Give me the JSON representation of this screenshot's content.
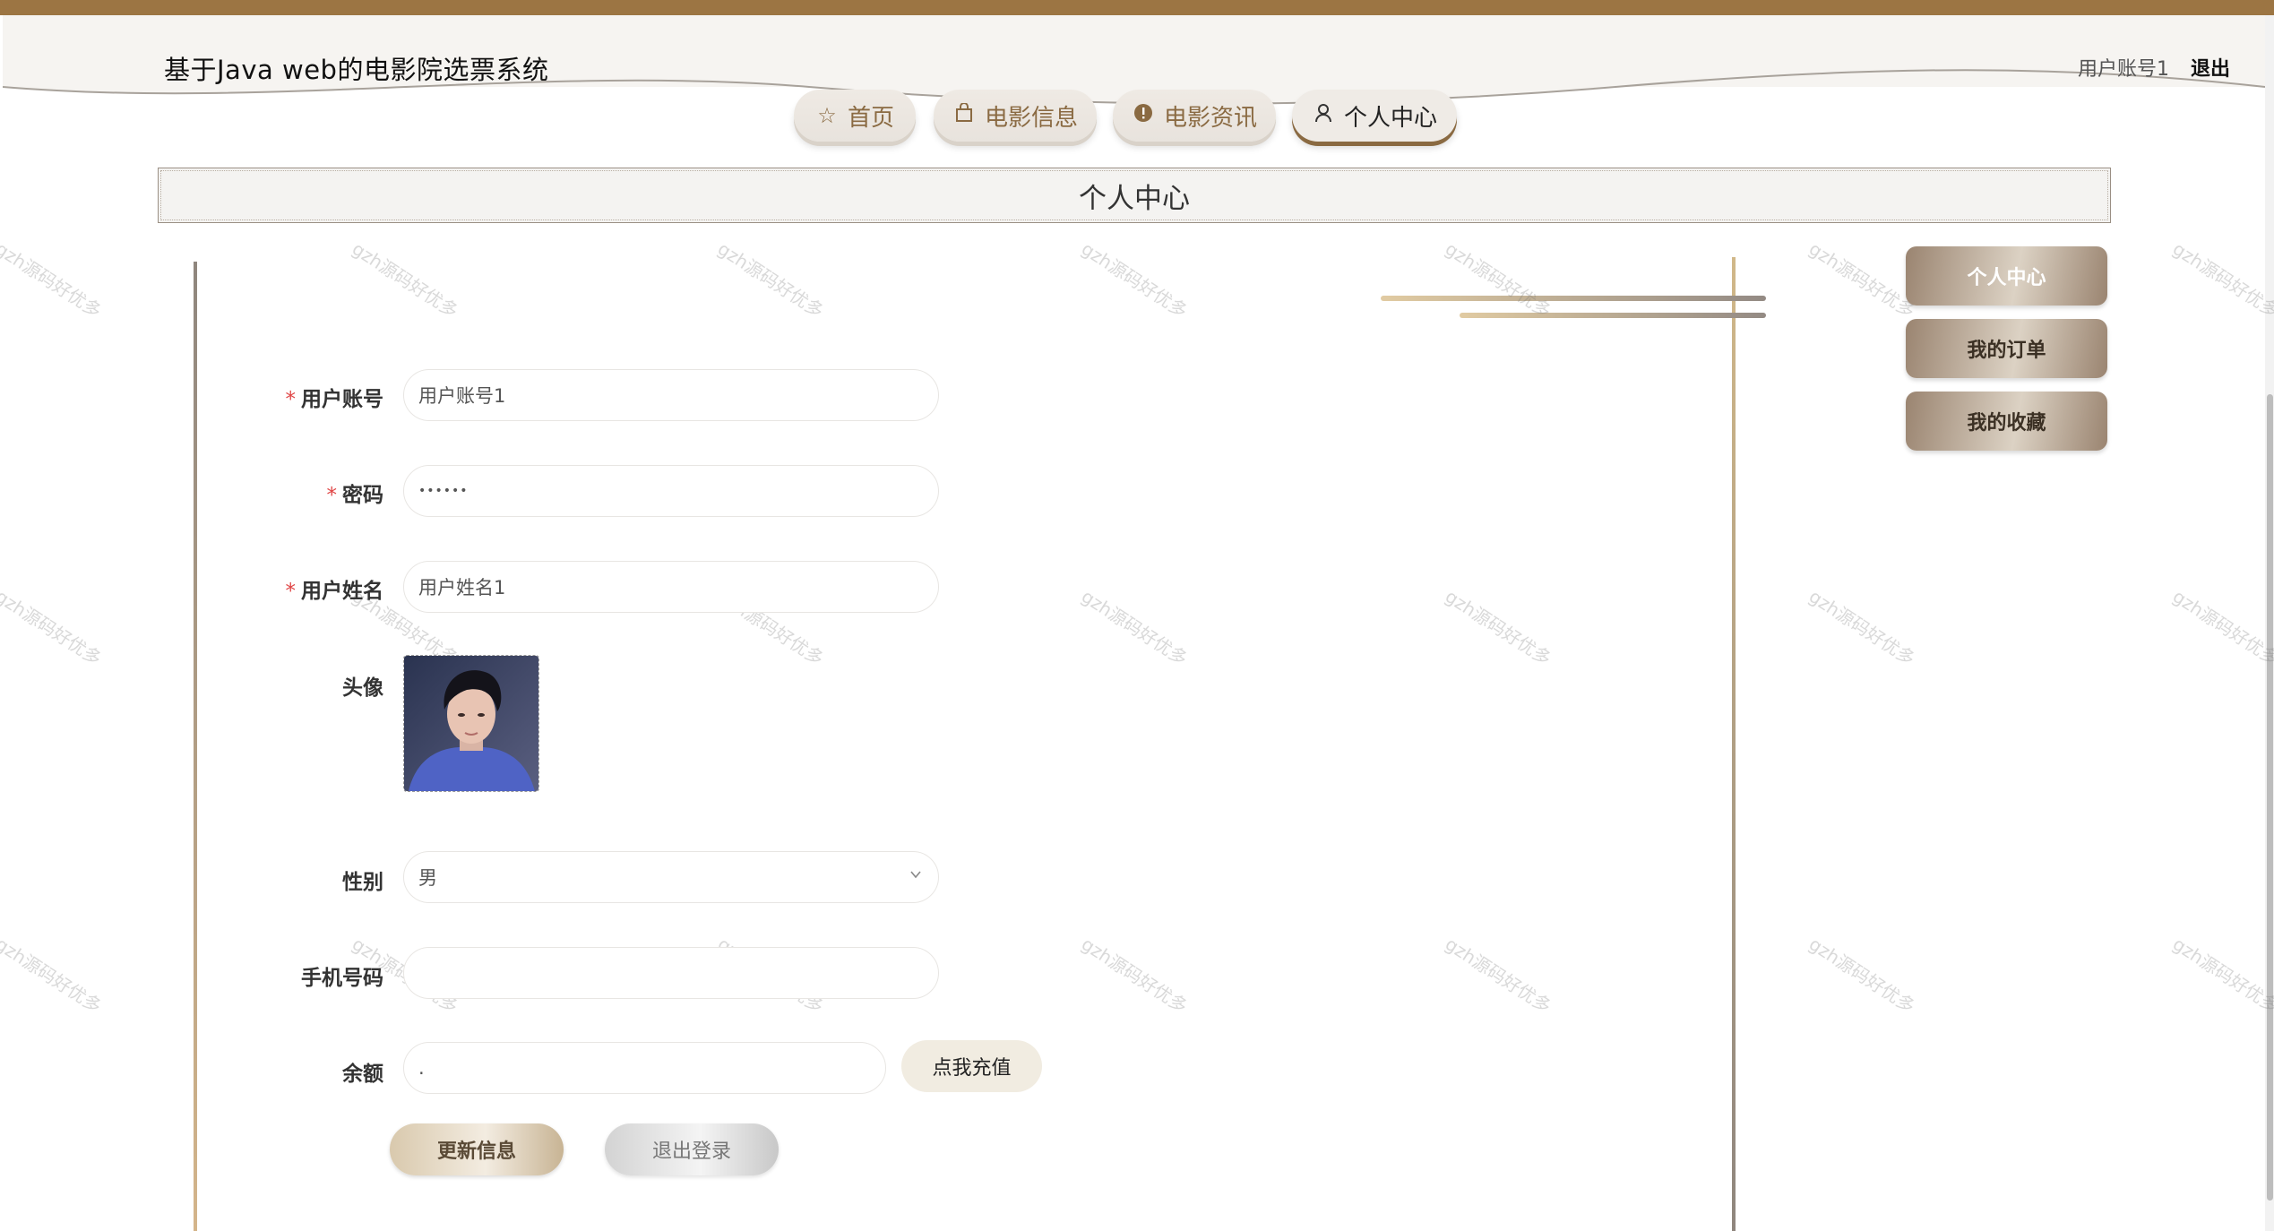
{
  "header": {
    "site_title": "基于Java web的电影院选票系统",
    "user_account": "用户账号1",
    "logout_link": "退出"
  },
  "nav": {
    "items": [
      {
        "label": "首页",
        "icon": "star-icon"
      },
      {
        "label": "电影信息",
        "icon": "shopping-bag-icon"
      },
      {
        "label": "电影资讯",
        "icon": "info-circle-icon"
      },
      {
        "label": "个人中心",
        "icon": "user-icon",
        "active": true
      }
    ]
  },
  "page": {
    "title": "个人中心"
  },
  "form": {
    "account": {
      "label": "用户账号",
      "value": "用户账号1",
      "required": true
    },
    "password": {
      "label": "密码",
      "value": "••••••",
      "required": true
    },
    "name": {
      "label": "用户姓名",
      "value": "用户姓名1",
      "required": true
    },
    "avatar": {
      "label": "头像"
    },
    "gender": {
      "label": "性别",
      "value": "男"
    },
    "phone": {
      "label": "手机号码",
      "value": ""
    },
    "balance": {
      "label": "余额",
      "value": "."
    },
    "recharge_button": "点我充值",
    "update_button": "更新信息",
    "logout_button": "退出登录"
  },
  "side_menu": {
    "items": [
      {
        "label": "个人中心",
        "active": true
      },
      {
        "label": "我的订单"
      },
      {
        "label": "我的收藏"
      }
    ]
  },
  "watermark": "gzh源码好优多",
  "colors": {
    "brand_brown": "#9c7543",
    "required_mark": "#e04646"
  }
}
